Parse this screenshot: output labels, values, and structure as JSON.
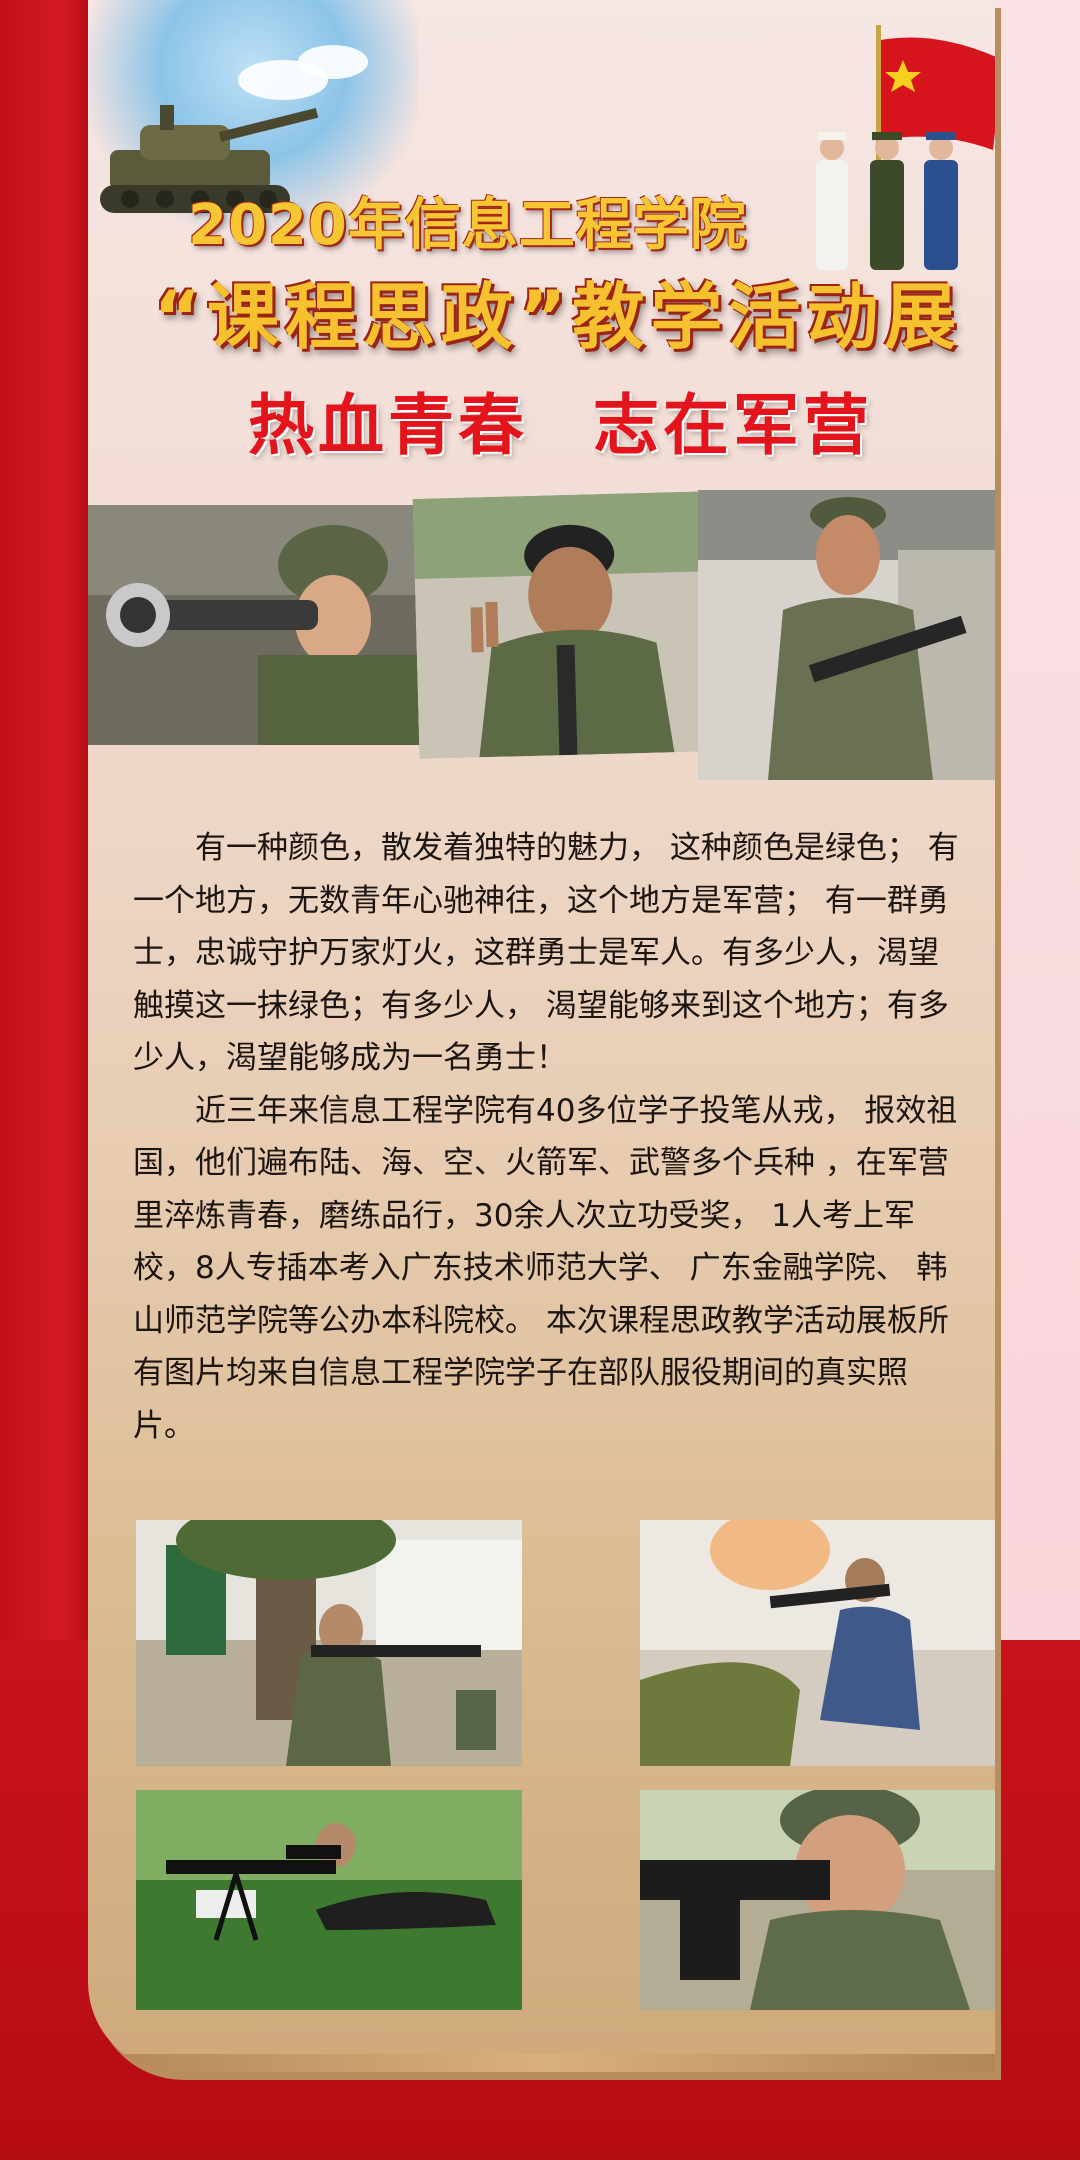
{
  "header": {
    "title_line1": "2020年信息工程学院",
    "title_line2": "“课程思政”教学活动展",
    "slogan_left": "热血青春",
    "slogan_right": "志在军营"
  },
  "body": {
    "paragraph1": "有一种颜色，散发着独特的魅力， 这种颜色是绿色； 有一个地方，无数青年心驰神往，这个地方是军营； 有一群勇士，忠诚守护万家灯火，这群勇士是军人。有多少人，渴望触摸这一抹绿色；有多少人， 渴望能够来到这个地方；有多少人，渴望能够成为一名勇士！",
    "paragraph2": "近三年来信息工程学院有40多位学子投笔从戎， 报效祖国，他们遍布陆、海、空、火箭军、武警多个兵种 ，在军营里淬炼青春，磨练品行，30余人次立功受奖， 1人考上军 校，8人专插本考入广东技术师范大学、 广东金融学院、 韩山师范学院等公办本科院校。 本次课程思政教学活动展板所有图片均来自信息工程学院学子在部队服役期间的真实照片。"
  },
  "photos": {
    "top": [
      "soldier-aiming-rifle-photo",
      "soldier-peace-sign-photo",
      "soldier-standing-with-rifle-photo"
    ],
    "grid": [
      "soldier-kneeling-aiming-photo",
      "soldier-firing-rifle-beach-photo",
      "soldier-prone-sniper-photo",
      "soldier-closeup-rifle-photo"
    ]
  },
  "colors": {
    "primary_red": "#c8141c",
    "title_gold": "#f6c12e",
    "slogan_red": "#e4141c",
    "panel_tan": "#d8b98e"
  }
}
